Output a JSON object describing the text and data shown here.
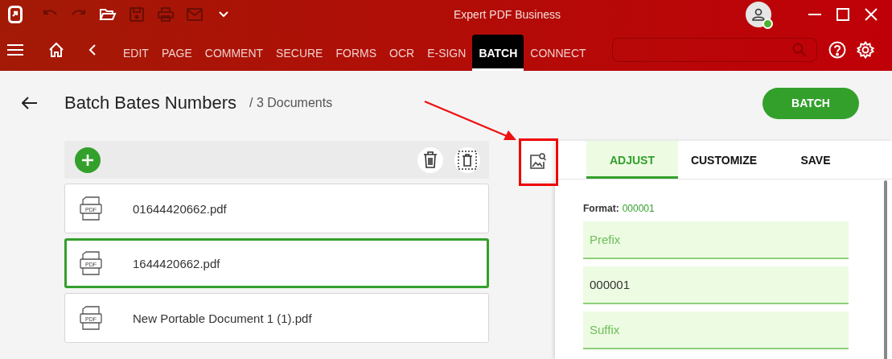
{
  "window": {
    "title": "Expert PDF Business"
  },
  "quick_access": [
    {
      "kind": "undo",
      "disabled": true
    },
    {
      "kind": "redo",
      "disabled": true
    },
    {
      "kind": "open",
      "disabled": false
    },
    {
      "kind": "save",
      "disabled": true
    },
    {
      "kind": "print",
      "disabled": true
    },
    {
      "kind": "mail",
      "disabled": true
    },
    {
      "kind": "more",
      "disabled": false
    }
  ],
  "menu_tabs": [
    {
      "label": "EDIT",
      "selected": false
    },
    {
      "label": "PAGE",
      "selected": false
    },
    {
      "label": "COMMENT",
      "selected": false
    },
    {
      "label": "SECURE",
      "selected": false
    },
    {
      "label": "FORMS",
      "selected": false
    },
    {
      "label": "OCR",
      "selected": false
    },
    {
      "label": "E-SIGN",
      "selected": false
    },
    {
      "label": "BATCH",
      "selected": true
    },
    {
      "label": "CONNECT",
      "selected": false
    }
  ],
  "page": {
    "title": "Batch Bates Numbers",
    "subtitle": "/ 3 Documents",
    "action": "BATCH"
  },
  "documents": [
    {
      "icon_label": "PDF",
      "name": "01644420662.pdf",
      "selected": false
    },
    {
      "icon_label": "PDF",
      "name": "1644420662.pdf",
      "selected": true
    },
    {
      "icon_label": "PDF",
      "name": "New Portable Document 1 (1).pdf",
      "selected": false
    }
  ],
  "panel_tabs": [
    {
      "label": "ADJUST",
      "selected": true
    },
    {
      "label": "CUSTOMIZE",
      "selected": false
    },
    {
      "label": "SAVE",
      "selected": false
    }
  ],
  "format": {
    "label": "Format:",
    "value": "000001"
  },
  "fields": [
    {
      "placeholder": "Prefix"
    },
    {
      "value": "000001"
    },
    {
      "placeholder": "Suffix"
    }
  ]
}
